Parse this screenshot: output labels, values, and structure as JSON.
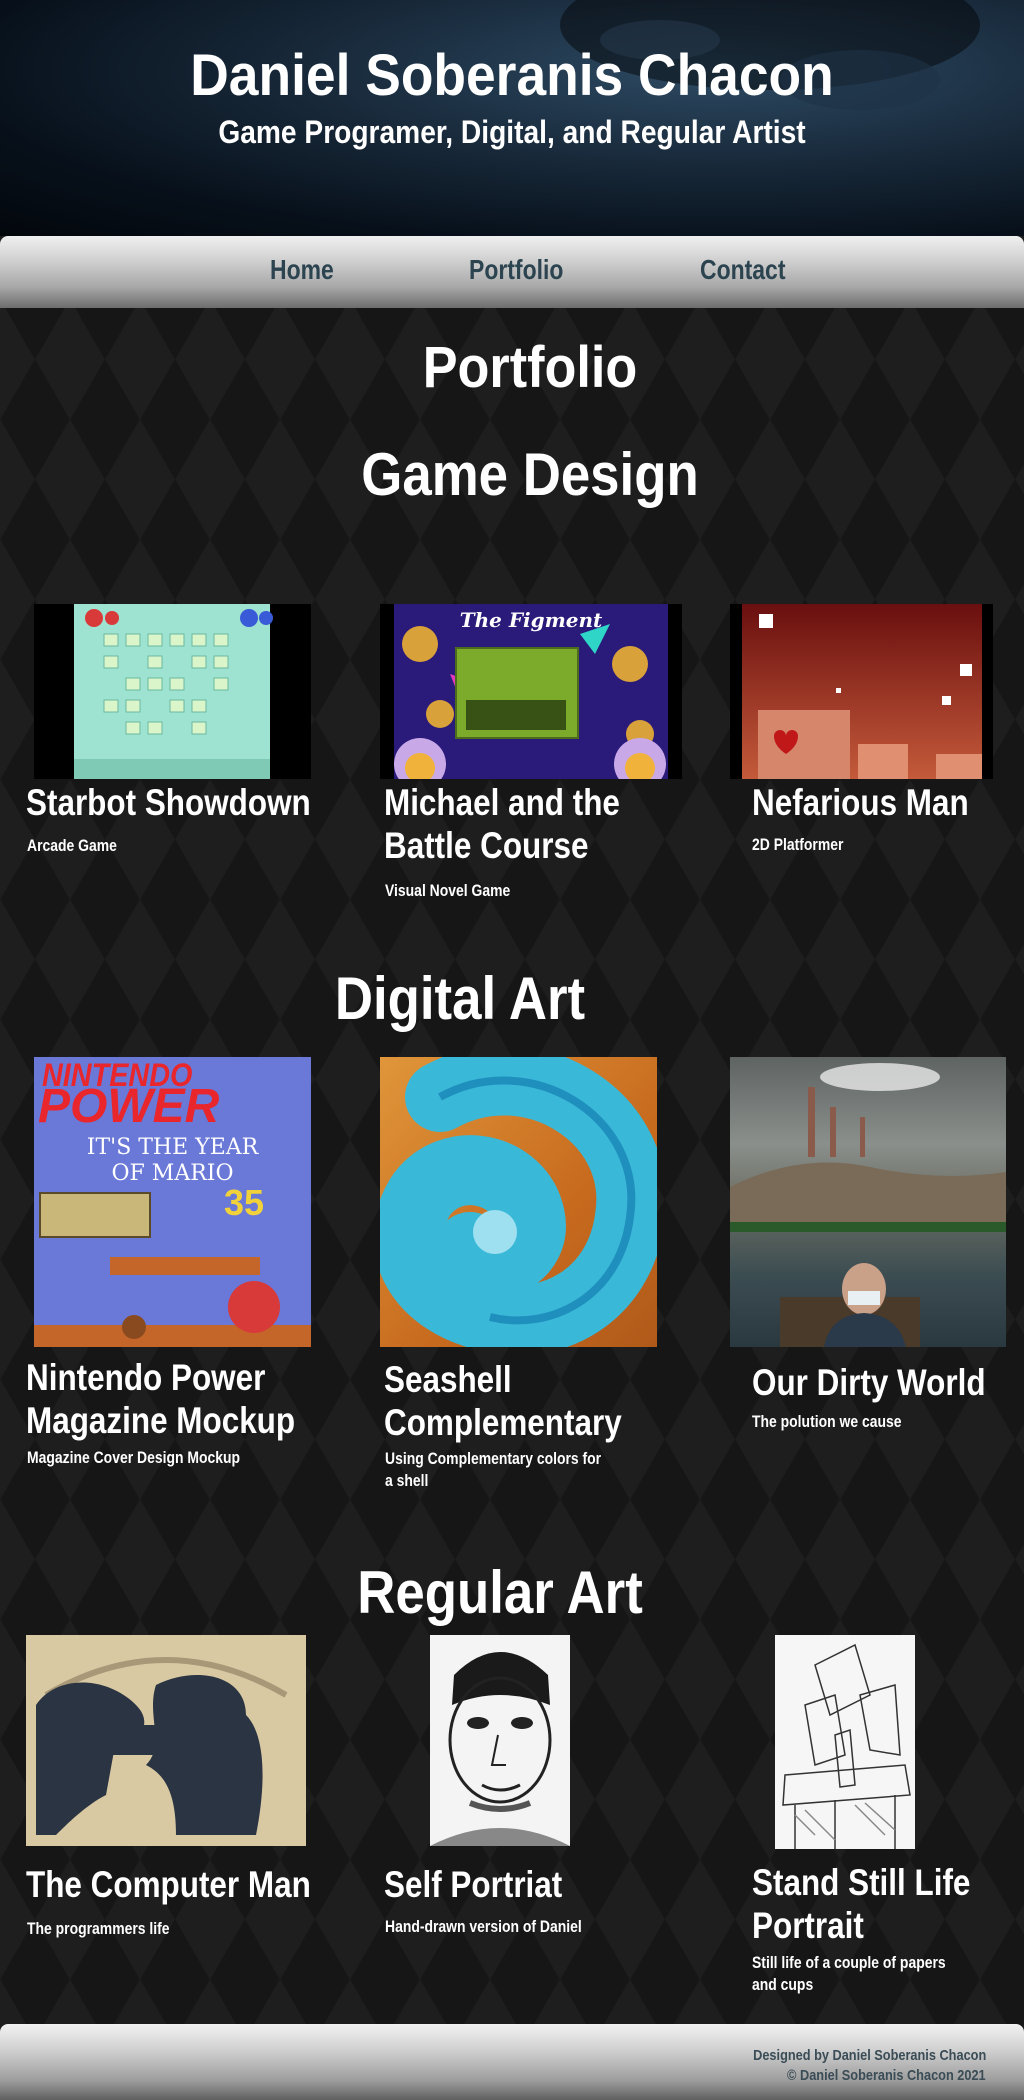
{
  "header": {
    "title": "Daniel Soberanis Chacon",
    "subtitle": "Game Programer, Digital, and Regular Artist"
  },
  "nav": {
    "items": [
      {
        "label": "Home"
      },
      {
        "label": "Portfolio"
      },
      {
        "label": "Contact"
      }
    ]
  },
  "page": {
    "heading": "Portfolio"
  },
  "sections": {
    "game_design": {
      "title": "Game Design",
      "items": [
        {
          "title": "Starbot Showdown",
          "subtitle": "Arcade Game"
        },
        {
          "title_line1": "Michael and the",
          "title_line2": "Battle Course",
          "subtitle": "Visual Novel Game",
          "image_text": "The Figment"
        },
        {
          "title": "Nefarious Man",
          "subtitle": "2D Platformer"
        }
      ]
    },
    "digital_art": {
      "title": "Digital Art",
      "items": [
        {
          "title_line1": "Nintendo Power",
          "title_line2": "Magazine Mockup",
          "subtitle": "Magazine Cover Design Mockup",
          "cover_logo1": "NINTENDO",
          "cover_logo2": "POWER",
          "cover_line1": "IT'S THE YEAR",
          "cover_line2": "OF MARIO",
          "cover_badge": "35"
        },
        {
          "title_line1": "Seashell",
          "title_line2": "Complementary",
          "subtitle_line1": "Using Complementary colors for",
          "subtitle_line2": "a shell"
        },
        {
          "title": "Our Dirty World",
          "subtitle": "The polution we cause"
        }
      ]
    },
    "regular_art": {
      "title": "Regular Art",
      "items": [
        {
          "title": "The Computer Man",
          "subtitle": "The programmers life"
        },
        {
          "title": "Self Portriat",
          "subtitle": "Hand-drawn version of Daniel"
        },
        {
          "title_line1": "Stand Still Life",
          "title_line2": "Portrait",
          "subtitle_line1": "Still life of a couple of papers",
          "subtitle_line2": "and cups"
        }
      ]
    }
  },
  "footer": {
    "designed_by": "Designed by Daniel Soberanis Chacon",
    "copyright": "© Daniel Soberanis Chacon 2021"
  },
  "colors": {
    "nav_text": "#2c4450",
    "page_bg": "#161616",
    "footer_text": "#3a4c56"
  }
}
